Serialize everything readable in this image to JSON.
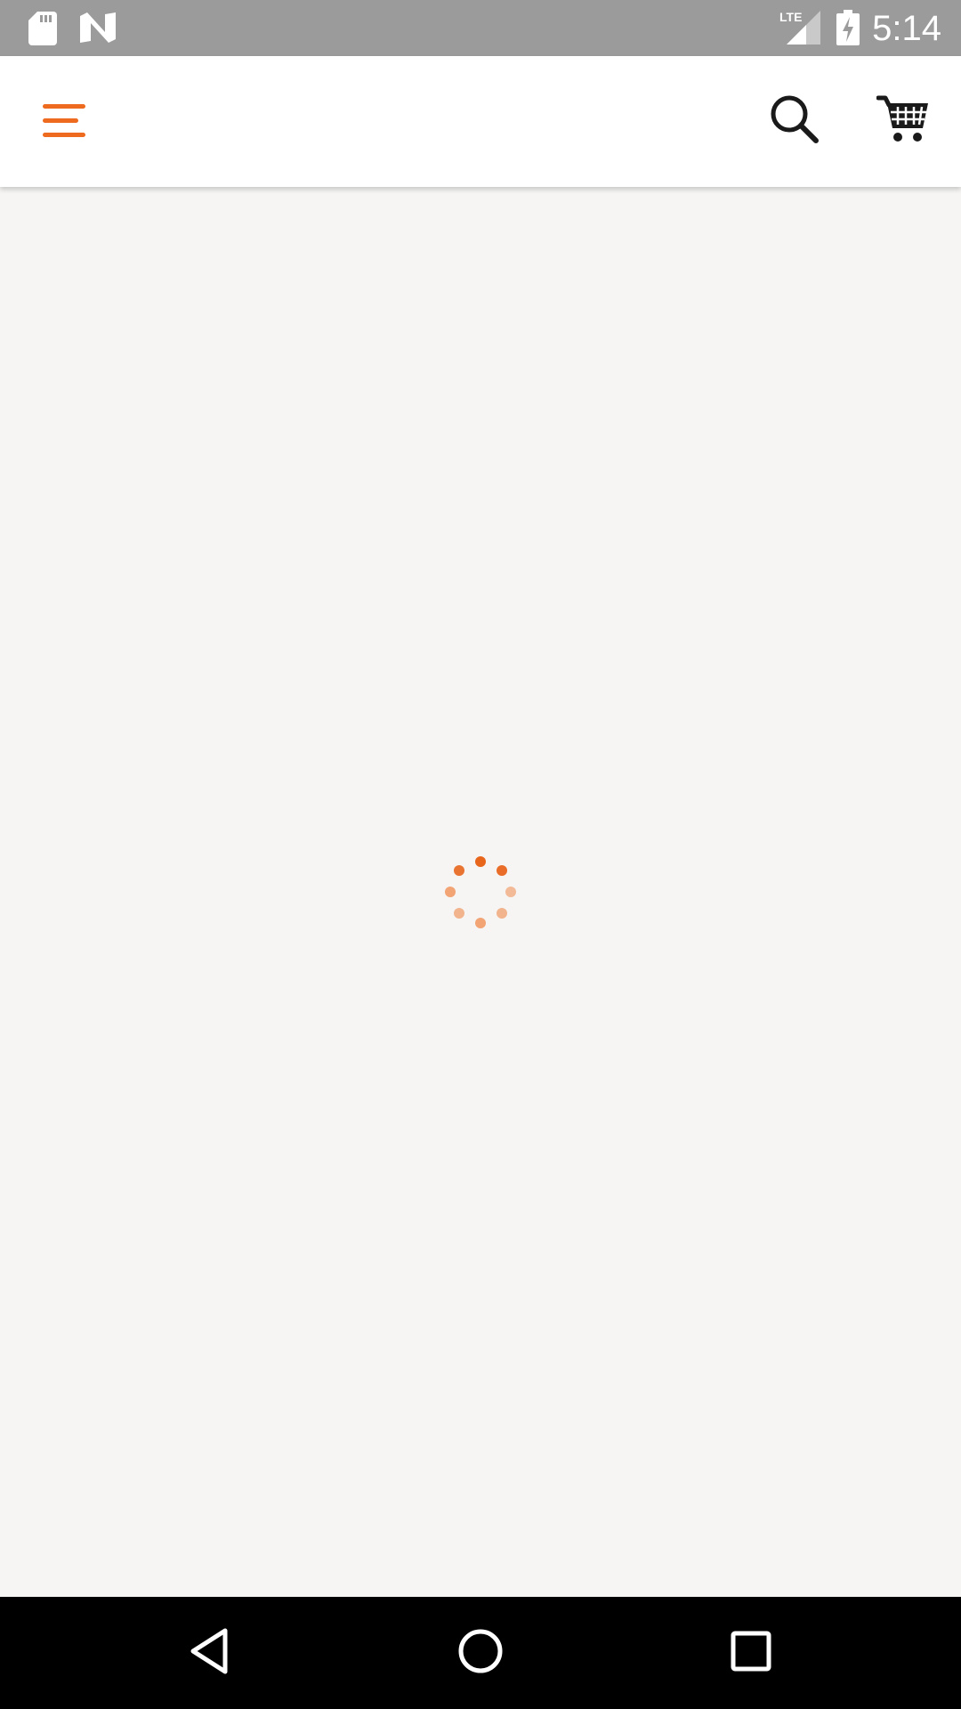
{
  "status_bar": {
    "time": "5:14",
    "network_label": "LTE",
    "icons": [
      "sd-card-icon",
      "n-logo-icon",
      "lte-signal-icon",
      "battery-charging-icon"
    ]
  },
  "app_bar": {
    "icons": {
      "menu": "hamburger-menu-icon",
      "search": "search-icon",
      "cart": "cart-icon"
    },
    "accent_color": "#ee6a1e"
  },
  "content": {
    "state": "loading",
    "spinner_color": "#ee6a1e",
    "background_color": "#f6f5f3"
  },
  "nav_bar": {
    "icons": [
      "back-icon",
      "home-icon",
      "recents-icon"
    ]
  }
}
